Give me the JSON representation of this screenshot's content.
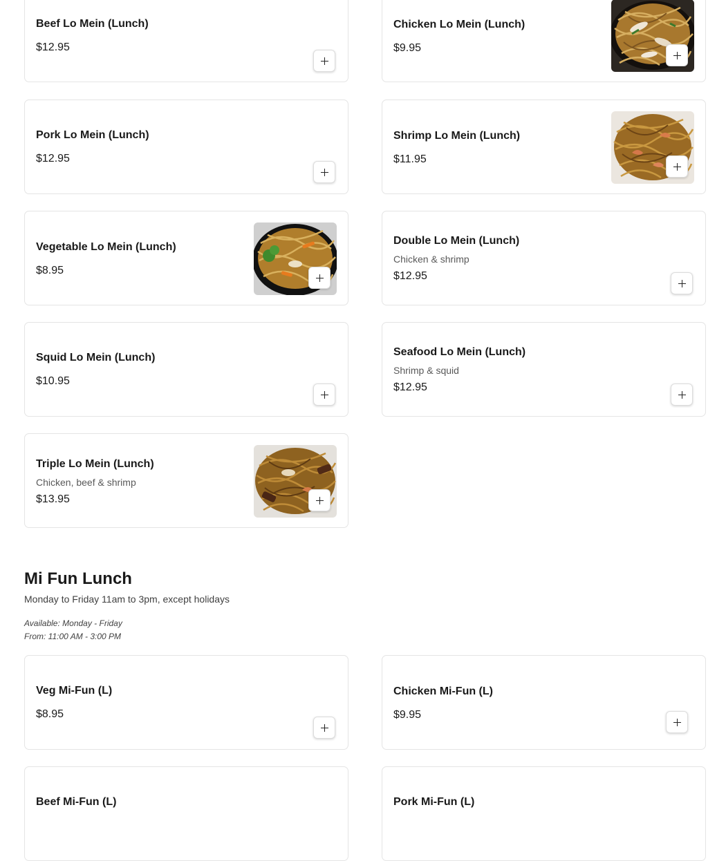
{
  "menu_items": [
    {
      "name": "Beef Lo Mein (Lunch)",
      "price": "$12.95"
    },
    {
      "name": "Chicken Lo Mein (Lunch)",
      "price": "$9.95",
      "image": "lo-mein-photo"
    },
    {
      "name": "Pork Lo Mein (Lunch)",
      "price": "$12.95"
    },
    {
      "name": "Shrimp Lo Mein (Lunch)",
      "price": "$11.95",
      "image": "lo-mein-photo"
    },
    {
      "name": "Vegetable Lo Mein (Lunch)",
      "price": "$8.95",
      "image": "lo-mein-photo"
    },
    {
      "name": "Double Lo Mein (Lunch)",
      "description": "Chicken & shrimp",
      "price": "$12.95"
    },
    {
      "name": "Squid Lo Mein (Lunch)",
      "price": "$10.95"
    },
    {
      "name": "Seafood Lo Mein (Lunch)",
      "description": "Shrimp & squid",
      "price": "$12.95"
    },
    {
      "name": "Triple Lo Mein (Lunch)",
      "description": "Chicken, beef & shrimp",
      "price": "$13.95",
      "image": "lo-mein-photo"
    }
  ],
  "section": {
    "title": "Mi Fun Lunch",
    "subtitle": "Monday to Friday 11am to 3pm, except holidays",
    "available": "Available: Monday - Friday",
    "hours": "From: 11:00 AM - 3:00 PM",
    "items": [
      {
        "name": "Veg Mi-Fun (L)",
        "price": "$8.95"
      },
      {
        "name": "Chicken Mi-Fun (L)",
        "price": "$9.95"
      },
      {
        "name": "Beef Mi-Fun (L)"
      },
      {
        "name": "Pork Mi-Fun (L)"
      }
    ]
  },
  "icons": {
    "add": "plus-icon"
  },
  "colors": {
    "text": "#191919",
    "muted": "#595959",
    "border": "#e4e4e4",
    "background": "#ffffff"
  }
}
